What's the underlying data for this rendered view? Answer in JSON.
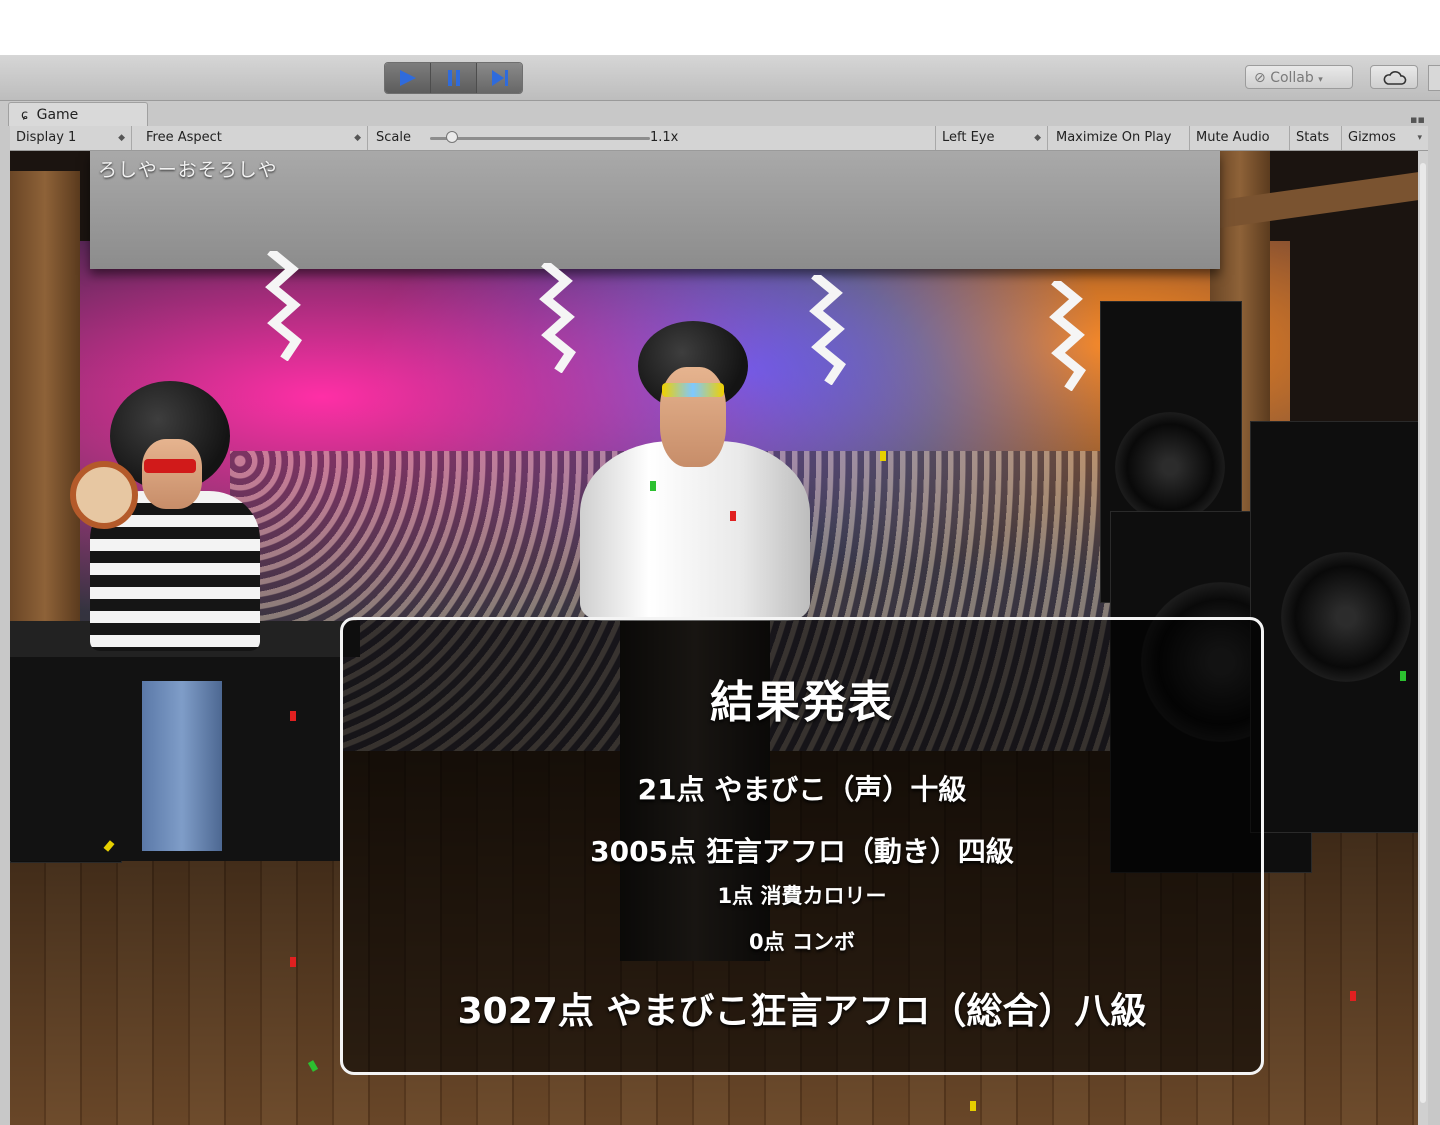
{
  "editor": {
    "toolbar": {
      "play_label": "Play",
      "pause_label": "Pause",
      "step_label": "Step",
      "collab_label": "Collab",
      "cloud_label": "Cloud",
      "accent_color": "#2f6bdc"
    },
    "tab": {
      "label": "Game",
      "icon": "game-controller-icon"
    },
    "gamebar": {
      "display": "Display 1",
      "aspect": "Free Aspect",
      "scale_label": "Scale",
      "scale_value": "1.1x",
      "eye": "Left Eye",
      "maximize": "Maximize On Play",
      "mute": "Mute Audio",
      "stats": "Stats",
      "gizmos": "Gizmos"
    }
  },
  "game": {
    "banner_text": "ろしやーおそろしや",
    "banner_score": "...",
    "results": {
      "title": "結果発表",
      "voice": "21点 やまびこ（声）十級",
      "motion": "3005点 狂言アフロ（動き）四級",
      "calories": "1点 消費カロリー",
      "combo": "0点 コンボ",
      "total": "3027点 やまびこ狂言アフロ（総合）八級"
    }
  }
}
